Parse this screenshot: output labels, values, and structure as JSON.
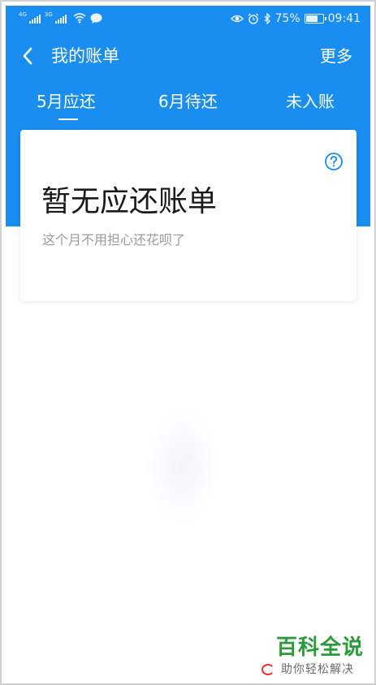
{
  "status_bar": {
    "network_1": "4G",
    "network_2": "3G",
    "battery_text": "75%",
    "battery_level": 0.75,
    "time": "09:41"
  },
  "nav": {
    "title": "我的账单",
    "more_label": "更多"
  },
  "tabs": [
    {
      "label": "5月应还",
      "selected": true
    },
    {
      "label": "6月待还",
      "selected": false
    },
    {
      "label": "未入账",
      "selected": false
    }
  ],
  "card": {
    "title": "暂无应还账单",
    "subtitle": "这个月不用担心还花呗了"
  },
  "watermark": {
    "title": "百科全说",
    "subtitle": "助你轻松解决"
  },
  "colors": {
    "primary": "#1a8df0",
    "watermark_green": "#2a9a3a"
  },
  "icons": [
    "signal-icon",
    "wifi-icon",
    "message-icon",
    "eye-icon",
    "alarm-icon",
    "bluetooth-icon",
    "battery-icon",
    "back-arrow-icon",
    "help-icon"
  ]
}
